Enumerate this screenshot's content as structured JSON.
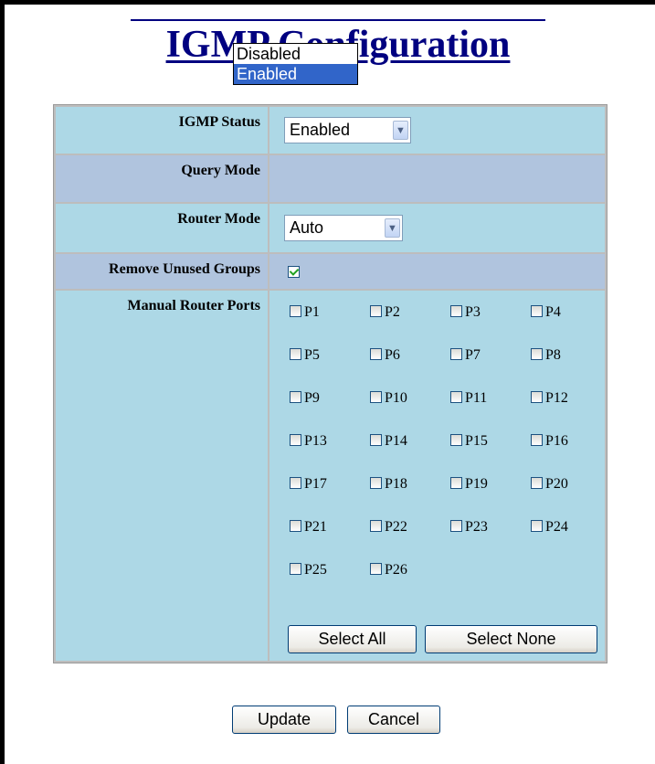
{
  "page": {
    "title": "IGMP Configuration"
  },
  "igmp_status": {
    "label": "IGMP Status",
    "value": "Enabled",
    "options": [
      "Disabled",
      "Enabled"
    ],
    "highlighted_option": "Enabled"
  },
  "query_mode": {
    "label": "Query Mode"
  },
  "router_mode": {
    "label": "Router Mode",
    "value": "Auto"
  },
  "remove_unused_groups": {
    "label": "Remove Unused Groups",
    "checked": true
  },
  "manual_router_ports": {
    "label": "Manual Router Ports",
    "ports": [
      {
        "label": "P1",
        "checked": false
      },
      {
        "label": "P2",
        "checked": false
      },
      {
        "label": "P3",
        "checked": false
      },
      {
        "label": "P4",
        "checked": false
      },
      {
        "label": "P5",
        "checked": false
      },
      {
        "label": "P6",
        "checked": false
      },
      {
        "label": "P7",
        "checked": false
      },
      {
        "label": "P8",
        "checked": false
      },
      {
        "label": "P9",
        "checked": false
      },
      {
        "label": "P10",
        "checked": false
      },
      {
        "label": "P11",
        "checked": false
      },
      {
        "label": "P12",
        "checked": false
      },
      {
        "label": "P13",
        "checked": false
      },
      {
        "label": "P14",
        "checked": false
      },
      {
        "label": "P15",
        "checked": false
      },
      {
        "label": "P16",
        "checked": false
      },
      {
        "label": "P17",
        "checked": false
      },
      {
        "label": "P18",
        "checked": false
      },
      {
        "label": "P19",
        "checked": false
      },
      {
        "label": "P20",
        "checked": false
      },
      {
        "label": "P21",
        "checked": false
      },
      {
        "label": "P22",
        "checked": false
      },
      {
        "label": "P23",
        "checked": false
      },
      {
        "label": "P24",
        "checked": false
      },
      {
        "label": "P25",
        "checked": false
      },
      {
        "label": "P26",
        "checked": false
      }
    ],
    "select_all_label": "Select All",
    "select_none_label": "Select None"
  },
  "actions": {
    "update_label": "Update",
    "cancel_label": "Cancel"
  },
  "colors": {
    "title": "#000080",
    "row_blue": "#add8e6",
    "row_gray": "#b0c4de",
    "dropdown_highlight": "#3165c9"
  },
  "icons": {
    "select_arrow": "chevron-down-icon",
    "checkbox_checked": "check-icon"
  }
}
